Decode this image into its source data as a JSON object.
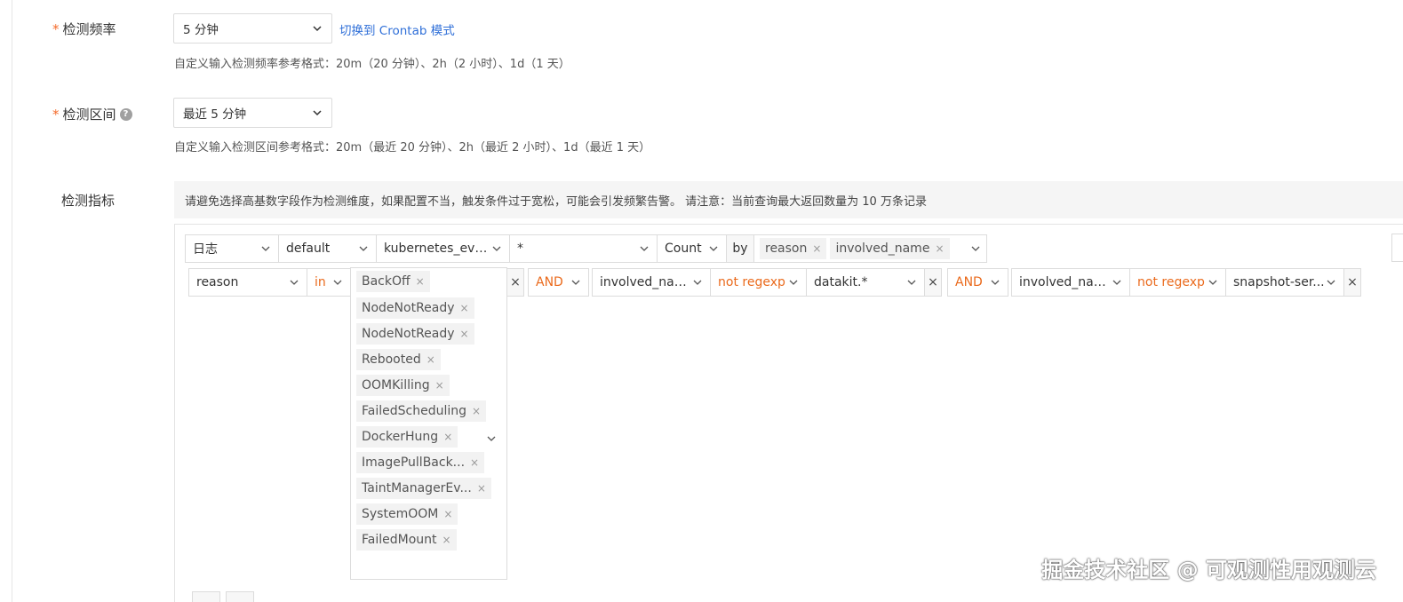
{
  "frequency": {
    "label": "检测频率",
    "required_mark": "*",
    "value": "5 分钟",
    "switch_link": "切换到 Crontab 模式",
    "hint": "自定义输入检测频率参考格式：20m（20 分钟）、2h（2 小时）、1d（1 天）"
  },
  "interval": {
    "label": "检测区间",
    "required_mark": "*",
    "help_icon": "?",
    "value": "最近 5 分钟",
    "hint": "自定义输入检测区间参考格式：20m（最近 20 分钟）、2h（最近 2 小时）、1d（最近 1 天）"
  },
  "metrics": {
    "label": "检测指标",
    "notice": "请避免选择高基数字段作为检测维度，如果配置不当，触发条件过于宽松，可能会引发频繁告警。 请注意：当前查询最大返回数量为 10 万条记录",
    "query": {
      "datasource": "日志",
      "index": "default",
      "source": "kubernetes_eve...",
      "field": "*",
      "func": "Count",
      "by_label": "by",
      "group_tags": [
        "reason",
        "involved_name"
      ]
    },
    "filters": [
      {
        "field": "reason",
        "op": "in",
        "values": [
          "BackOff",
          "NodeNotReady",
          "NodeNotReady",
          "Rebooted",
          "OOMKilling",
          "FailedScheduling",
          "DockerHung",
          "ImagePullBack...",
          "TaintManagerEv...",
          "SystemOOM",
          "FailedMount"
        ]
      },
      {
        "logic": "AND",
        "field": "involved_name",
        "op": "not regexp",
        "value": "datakit.*"
      },
      {
        "logic": "AND",
        "field": "involved_name",
        "op": "not regexp",
        "value": "snapshot-ser..."
      }
    ],
    "remove_glyph": "×",
    "tag_remove_glyph": "×"
  },
  "watermark": "掘金技术社区 @ 可观测性用观测云",
  "colors": {
    "accent_link": "#2f6fd8",
    "operator_orange": "#ea6a1c",
    "required": "#f56c2d"
  }
}
